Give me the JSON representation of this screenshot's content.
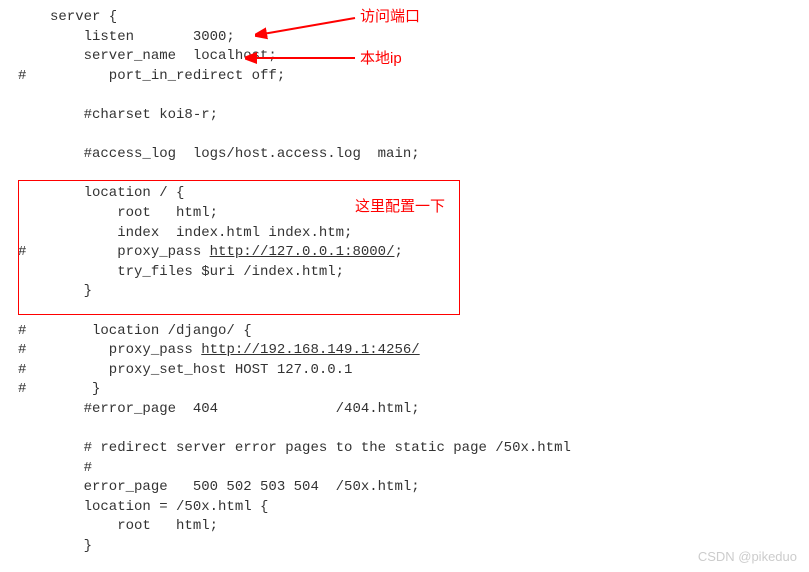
{
  "annotations": {
    "port_label": "访问端口",
    "localip_label": "本地ip",
    "config_label": "这里配置一下"
  },
  "gutter": {
    "hash": "#"
  },
  "code": {
    "l1": "server {",
    "l2": "    listen       3000;",
    "l3": "    server_name  localhost;",
    "l4": "       port_in_redirect off;",
    "l5": "",
    "l6": "    #charset koi8-r;",
    "l7": "",
    "l8": "    #access_log  logs/host.access.log  main;",
    "l9": "",
    "l10": "    location / {",
    "l11": "        root   html;",
    "l12": "        index  index.html index.htm;",
    "l13_a": "        proxy_pass ",
    "l13_b": "http://127.0.0.1:8000/",
    "l13_c": ";",
    "l14": "        try_files $uri /index.html;",
    "l15": "    }",
    "l16": "",
    "l17": "     location /django/ {",
    "l18_a": "       proxy_pass ",
    "l18_b": "http://192.168.149.1:4256/",
    "l19": "       proxy_set_host HOST 127.0.0.1",
    "l20": "     }",
    "l21": "    #error_page  404              /404.html;",
    "l22": "",
    "l23": "    # redirect server error pages to the static page /50x.html",
    "l24": "    #",
    "l25": "    error_page   500 502 503 504  /50x.html;",
    "l26": "    location = /50x.html {",
    "l27": "        root   html;",
    "l28": "    }"
  },
  "watermark": "CSDN @pikeduo"
}
